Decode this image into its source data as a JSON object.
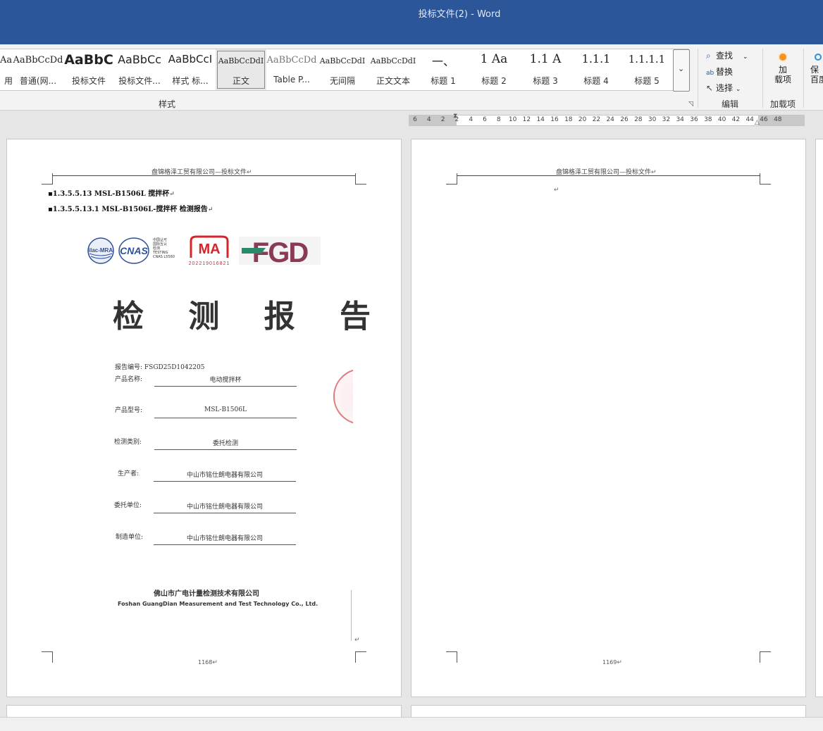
{
  "window": {
    "title": "投标文件(2)  -  Word",
    "accent": "#2b579a"
  },
  "styles": {
    "group_label": "样式",
    "items": [
      {
        "preview": "AaBbCcDd",
        "label": "用"
      },
      {
        "preview": "AaBbCcDd",
        "label": "普通(网..."
      },
      {
        "preview": "AaBbC",
        "label": "投标文件"
      },
      {
        "preview": "AaBbCc",
        "label": "投标文件..."
      },
      {
        "preview": "AaBbCcI",
        "label": "样式 标..."
      },
      {
        "preview": "AaBbCcDdI",
        "label": "正文"
      },
      {
        "preview": "AaBbCcDd",
        "label": "Table P..."
      },
      {
        "preview": "AaBbCcDdI",
        "label": "无间隔"
      },
      {
        "preview": "AaBbCcDdI",
        "label": "正文文本"
      },
      {
        "preview": "一、",
        "label": "标题 1"
      },
      {
        "preview": "1  Aa",
        "label": "标题 2"
      },
      {
        "preview": "1.1  A",
        "label": "标题 3"
      },
      {
        "preview": "1.1.1",
        "label": "标题 4"
      },
      {
        "preview": "1.1.1.1",
        "label": "标题 5"
      }
    ],
    "selected_index": 5
  },
  "editing": {
    "group_label": "编辑",
    "find": "查找",
    "replace": "替换",
    "select": "选择"
  },
  "addins": {
    "group_label": "加载项",
    "button": "加\n载项",
    "icon": "orange-dot-icon"
  },
  "save_group": {
    "partial_label": "保\n百度"
  },
  "ruler": {
    "ticks": [
      "6",
      "4",
      "2",
      "2",
      "4",
      "6",
      "8",
      "10",
      "12",
      "14",
      "16",
      "18",
      "20",
      "22",
      "24",
      "26",
      "28",
      "30",
      "32",
      "34",
      "36",
      "38",
      "40",
      "42",
      "44",
      "46",
      "48"
    ]
  },
  "pages": [
    {
      "header": "盘锦格泽工贸有限公司—投标文件",
      "headings": [
        "1.3.5.5.13 MSL-B1506L 搅拌杯",
        "1.3.5.5.13.1  MSL-B1506L-搅拌杯  检测报告"
      ],
      "report": {
        "logos": [
          "ilac-MRA",
          "CNAS",
          "中国认可 国际互认 检测 TESTING CNAS L5560",
          "CMA 202219016821",
          "FGD"
        ],
        "title": "检 测 报 告",
        "number_label": "报告编号:",
        "number_value": "FSGD25D1042205",
        "fields": [
          {
            "label": "产品名称:",
            "value": "电动搅拌杯"
          },
          {
            "label": "产品型号:",
            "value": "MSL-B1506L"
          },
          {
            "label": "检测类别:",
            "value": "委托检测"
          },
          {
            "label": "生产者:",
            "value": "中山市铭仕朗电器有限公司"
          },
          {
            "label": "委托单位:",
            "value": "中山市铭仕朗电器有限公司"
          },
          {
            "label": "制造单位:",
            "value": "中山市铭仕朗电器有限公司"
          }
        ],
        "issuer_cn": "佛山市广电计量检测技术有限公司",
        "issuer_en": "Foshan GuangDian Measurement and Test Technology Co., Ltd."
      },
      "page_number": "1168"
    },
    {
      "header": "盘锦格泽工贸有限公司—投标文件",
      "page_number": "1169"
    }
  ]
}
